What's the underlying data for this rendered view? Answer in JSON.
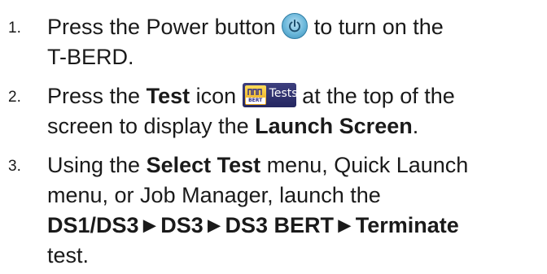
{
  "steps": [
    {
      "number": "1.",
      "line1_a": "Press the Power button",
      "line1_b": "to turn on the",
      "line2": "T-BERD."
    },
    {
      "number": "2.",
      "line1_a": "Press the",
      "line1_bold": "Test",
      "line1_b": "icon",
      "line1_c": "at the top of the",
      "line2_a": "screen to display the",
      "line2_bold": "Launch Screen",
      "line2_b": "."
    },
    {
      "number": "3.",
      "line1_a": "Using the",
      "line1_bold": "Select Test",
      "line1_b": "menu, Quick Launch",
      "line2": "menu, or Job Manager, launch the",
      "line3_bold": "DS1/DS3►DS3►DS3 BERT►Terminate",
      "line4": "test."
    }
  ],
  "icons": {
    "power": "power-icon",
    "test": "test-icon",
    "test_icon_label": "Tests",
    "test_icon_badge": "BERT"
  },
  "colors": {
    "text": "#1a1a1a",
    "power_icon": "#6ab7da",
    "test_icon_bg": "#2f316e",
    "test_icon_glyph": "#f2c038"
  }
}
